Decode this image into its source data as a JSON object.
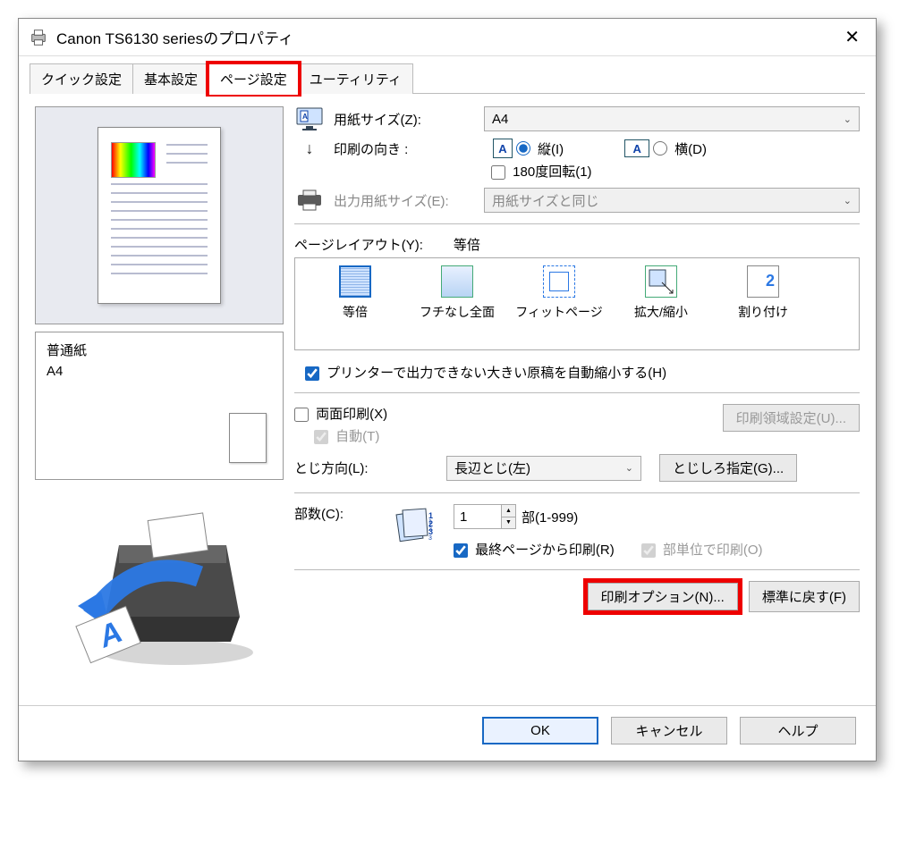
{
  "title": "Canon TS6130 seriesのプロパティ",
  "tabs": [
    "クイック設定",
    "基本設定",
    "ページ設定",
    "ユーティリティ"
  ],
  "active_tab_index": 2,
  "highlight_tab_index": 2,
  "preview": {
    "paper_type": "普通紙",
    "size": "A4"
  },
  "paper_size": {
    "label": "用紙サイズ(Z):",
    "value": "A4"
  },
  "orientation": {
    "label": "印刷の向き :",
    "portrait": "縦(I)",
    "landscape": "横(D)",
    "selected": "portrait",
    "rotate180": "180度回転(1)"
  },
  "output_size": {
    "label": "出力用紙サイズ(E):",
    "value": "用紙サイズと同じ"
  },
  "page_layout": {
    "label": "ページレイアウト(Y):",
    "current": "等倍",
    "options": [
      "等倍",
      "フチなし全面",
      "フィットページ",
      "拡大/縮小",
      "割り付け"
    ]
  },
  "auto_reduce": "プリンターで出力できない大きい原稿を自動縮小する(H)",
  "duplex": {
    "label": "両面印刷(X)",
    "auto": "自動(T)",
    "area_btn": "印刷領域設定(U)..."
  },
  "binding": {
    "label": "とじ方向(L):",
    "value": "長辺とじ(左)",
    "margin_btn": "とじしろ指定(G)..."
  },
  "copies": {
    "label": "部数(C):",
    "value": "1",
    "unit": "部(1-999)",
    "from_last": "最終ページから印刷(R)",
    "collate": "部単位で印刷(O)"
  },
  "buttons": {
    "print_options": "印刷オプション(N)...",
    "defaults": "標準に戻す(F)",
    "ok": "OK",
    "cancel": "キャンセル",
    "help": "ヘルプ"
  }
}
